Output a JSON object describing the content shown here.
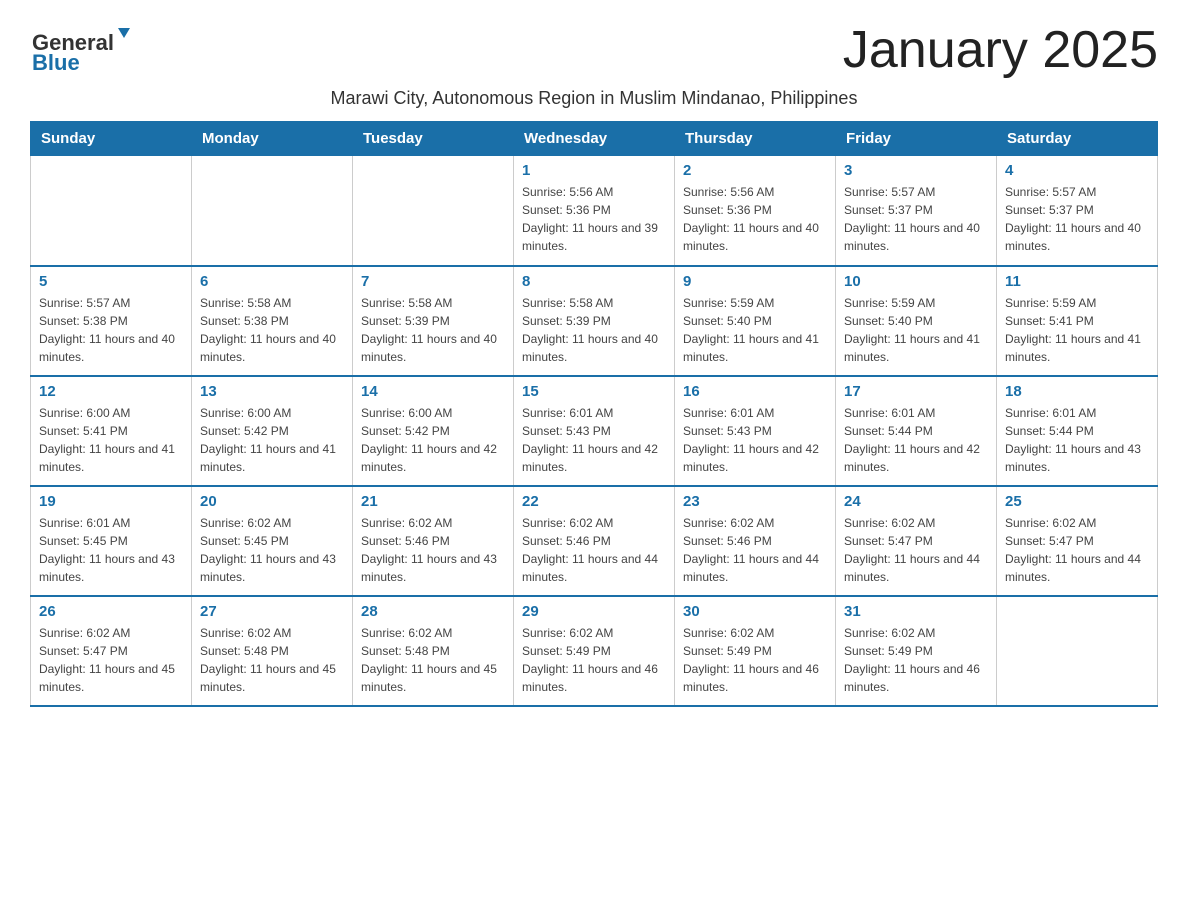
{
  "logo": {
    "general": "General",
    "blue": "Blue"
  },
  "title": "January 2025",
  "subtitle": "Marawi City, Autonomous Region in Muslim Mindanao, Philippines",
  "days_of_week": [
    "Sunday",
    "Monday",
    "Tuesday",
    "Wednesday",
    "Thursday",
    "Friday",
    "Saturday"
  ],
  "weeks": [
    [
      {
        "day": "",
        "info": ""
      },
      {
        "day": "",
        "info": ""
      },
      {
        "day": "",
        "info": ""
      },
      {
        "day": "1",
        "info": "Sunrise: 5:56 AM\nSunset: 5:36 PM\nDaylight: 11 hours and 39 minutes."
      },
      {
        "day": "2",
        "info": "Sunrise: 5:56 AM\nSunset: 5:36 PM\nDaylight: 11 hours and 40 minutes."
      },
      {
        "day": "3",
        "info": "Sunrise: 5:57 AM\nSunset: 5:37 PM\nDaylight: 11 hours and 40 minutes."
      },
      {
        "day": "4",
        "info": "Sunrise: 5:57 AM\nSunset: 5:37 PM\nDaylight: 11 hours and 40 minutes."
      }
    ],
    [
      {
        "day": "5",
        "info": "Sunrise: 5:57 AM\nSunset: 5:38 PM\nDaylight: 11 hours and 40 minutes."
      },
      {
        "day": "6",
        "info": "Sunrise: 5:58 AM\nSunset: 5:38 PM\nDaylight: 11 hours and 40 minutes."
      },
      {
        "day": "7",
        "info": "Sunrise: 5:58 AM\nSunset: 5:39 PM\nDaylight: 11 hours and 40 minutes."
      },
      {
        "day": "8",
        "info": "Sunrise: 5:58 AM\nSunset: 5:39 PM\nDaylight: 11 hours and 40 minutes."
      },
      {
        "day": "9",
        "info": "Sunrise: 5:59 AM\nSunset: 5:40 PM\nDaylight: 11 hours and 41 minutes."
      },
      {
        "day": "10",
        "info": "Sunrise: 5:59 AM\nSunset: 5:40 PM\nDaylight: 11 hours and 41 minutes."
      },
      {
        "day": "11",
        "info": "Sunrise: 5:59 AM\nSunset: 5:41 PM\nDaylight: 11 hours and 41 minutes."
      }
    ],
    [
      {
        "day": "12",
        "info": "Sunrise: 6:00 AM\nSunset: 5:41 PM\nDaylight: 11 hours and 41 minutes."
      },
      {
        "day": "13",
        "info": "Sunrise: 6:00 AM\nSunset: 5:42 PM\nDaylight: 11 hours and 41 minutes."
      },
      {
        "day": "14",
        "info": "Sunrise: 6:00 AM\nSunset: 5:42 PM\nDaylight: 11 hours and 42 minutes."
      },
      {
        "day": "15",
        "info": "Sunrise: 6:01 AM\nSunset: 5:43 PM\nDaylight: 11 hours and 42 minutes."
      },
      {
        "day": "16",
        "info": "Sunrise: 6:01 AM\nSunset: 5:43 PM\nDaylight: 11 hours and 42 minutes."
      },
      {
        "day": "17",
        "info": "Sunrise: 6:01 AM\nSunset: 5:44 PM\nDaylight: 11 hours and 42 minutes."
      },
      {
        "day": "18",
        "info": "Sunrise: 6:01 AM\nSunset: 5:44 PM\nDaylight: 11 hours and 43 minutes."
      }
    ],
    [
      {
        "day": "19",
        "info": "Sunrise: 6:01 AM\nSunset: 5:45 PM\nDaylight: 11 hours and 43 minutes."
      },
      {
        "day": "20",
        "info": "Sunrise: 6:02 AM\nSunset: 5:45 PM\nDaylight: 11 hours and 43 minutes."
      },
      {
        "day": "21",
        "info": "Sunrise: 6:02 AM\nSunset: 5:46 PM\nDaylight: 11 hours and 43 minutes."
      },
      {
        "day": "22",
        "info": "Sunrise: 6:02 AM\nSunset: 5:46 PM\nDaylight: 11 hours and 44 minutes."
      },
      {
        "day": "23",
        "info": "Sunrise: 6:02 AM\nSunset: 5:46 PM\nDaylight: 11 hours and 44 minutes."
      },
      {
        "day": "24",
        "info": "Sunrise: 6:02 AM\nSunset: 5:47 PM\nDaylight: 11 hours and 44 minutes."
      },
      {
        "day": "25",
        "info": "Sunrise: 6:02 AM\nSunset: 5:47 PM\nDaylight: 11 hours and 44 minutes."
      }
    ],
    [
      {
        "day": "26",
        "info": "Sunrise: 6:02 AM\nSunset: 5:47 PM\nDaylight: 11 hours and 45 minutes."
      },
      {
        "day": "27",
        "info": "Sunrise: 6:02 AM\nSunset: 5:48 PM\nDaylight: 11 hours and 45 minutes."
      },
      {
        "day": "28",
        "info": "Sunrise: 6:02 AM\nSunset: 5:48 PM\nDaylight: 11 hours and 45 minutes."
      },
      {
        "day": "29",
        "info": "Sunrise: 6:02 AM\nSunset: 5:49 PM\nDaylight: 11 hours and 46 minutes."
      },
      {
        "day": "30",
        "info": "Sunrise: 6:02 AM\nSunset: 5:49 PM\nDaylight: 11 hours and 46 minutes."
      },
      {
        "day": "31",
        "info": "Sunrise: 6:02 AM\nSunset: 5:49 PM\nDaylight: 11 hours and 46 minutes."
      },
      {
        "day": "",
        "info": ""
      }
    ]
  ]
}
